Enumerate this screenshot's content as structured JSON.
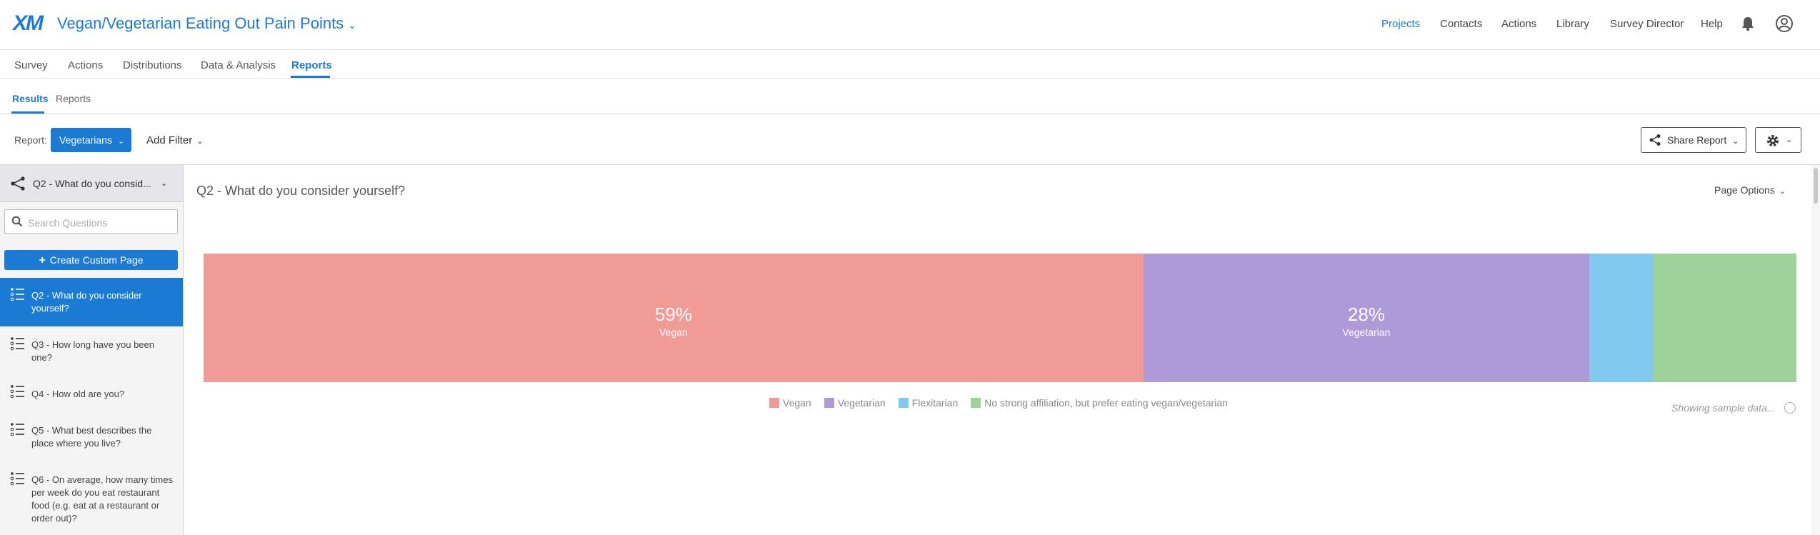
{
  "header": {
    "logo": "XM",
    "project_title": "Vegan/Vegetarian Eating Out Pain Points",
    "nav": [
      "Projects",
      "Contacts",
      "Actions",
      "Library",
      "Survey Director",
      "Help"
    ]
  },
  "tabs": [
    "Survey",
    "Actions",
    "Distributions",
    "Data & Analysis",
    "Reports"
  ],
  "subtabs": [
    "Results",
    "Reports"
  ],
  "toolbar": {
    "report_label": "Report:",
    "report_value": "Vegetarians",
    "add_filter": "Add Filter",
    "share_report": "Share Report"
  },
  "sidebar": {
    "selected": "Q2 - What do you consid...",
    "search_placeholder": "Search Questions",
    "create_label": "Create Custom Page",
    "questions": [
      "Q2 - What do you consider yourself?",
      "Q3 - How long have you been one?",
      "Q4 - How old are you?",
      "Q5 - What best describes the place where you live?",
      "Q6 - On average, how many times per week do you eat restaurant food (e.g. eat at a restaurant or order out)?"
    ]
  },
  "main": {
    "question_title": "Q2 - What do you consider yourself?",
    "page_options": "Page Options",
    "sample_note": "Showing sample data..."
  },
  "colors": {
    "accent": "#1b7bd4",
    "vegan": "#f09b96",
    "vegetarian": "#ae9ad8",
    "flexitarian": "#82c9f0",
    "no_affiliation": "#9fd29b"
  },
  "chart_data": {
    "type": "bar",
    "stacked": true,
    "orientation": "horizontal",
    "categories": [
      "Vegan",
      "Vegetarian",
      "Flexitarian",
      "No strong affiliation, but prefer eating vegan/vegetarian"
    ],
    "values": [
      59,
      28,
      4,
      9
    ],
    "value_labels": [
      "59%",
      "28%",
      "",
      ""
    ],
    "legend_position": "bottom"
  }
}
